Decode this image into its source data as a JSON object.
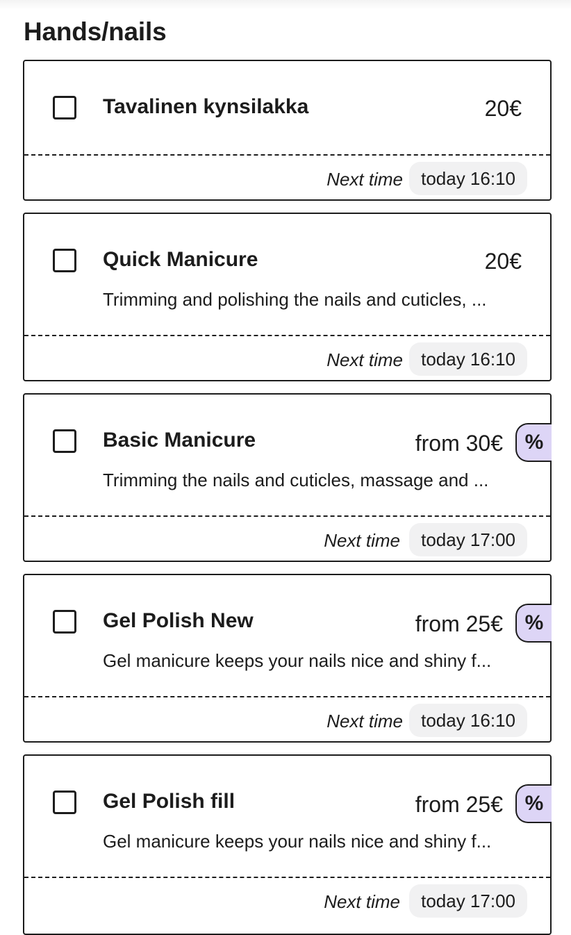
{
  "section": {
    "title": "Hands/nails"
  },
  "services": [
    {
      "name": "Tavalinen kynsilakka",
      "price": "20€",
      "description": "",
      "next_time_label": "Next time",
      "next_time": "today 16:10",
      "discount": false
    },
    {
      "name": "Quick Manicure",
      "price": "20€",
      "description": "Trimming and polishing the nails and cuticles, ...",
      "next_time_label": "Next time",
      "next_time": "today 16:10",
      "discount": false
    },
    {
      "name": "Basic Manicure",
      "price": "from 30€",
      "description": "Trimming the nails and cuticles, massage and ...",
      "next_time_label": "Next time",
      "next_time": "today 17:00",
      "discount": true,
      "discount_symbol": "%"
    },
    {
      "name": "Gel Polish New",
      "price": "from 25€",
      "description": "Gel manicure keeps your nails nice and shiny f...",
      "next_time_label": "Next time",
      "next_time": "today 16:10",
      "discount": true,
      "discount_symbol": "%"
    },
    {
      "name": "Gel Polish fill",
      "price": "from 25€",
      "description": "Gel manicure keeps your nails nice and shiny f...",
      "next_time_label": "Next time",
      "next_time": "today 17:00",
      "discount": true,
      "discount_symbol": "%"
    }
  ],
  "colors": {
    "text": "#1c1c1c",
    "pill_background": "#f1f1f2",
    "discount_badge": "#ddd5f6"
  },
  "icons": {
    "checkbox": "checkbox-unchecked-icon",
    "discount": "percent-icon"
  }
}
